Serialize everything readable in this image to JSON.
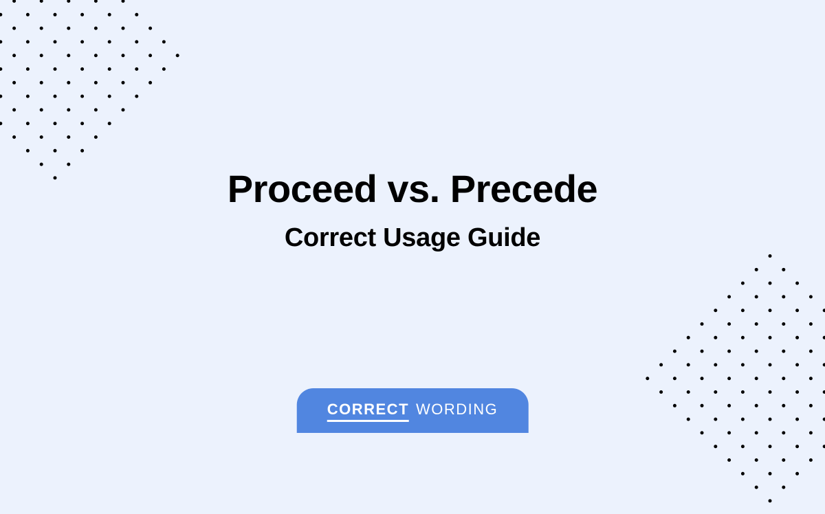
{
  "title": "Proceed vs. Precede",
  "subtitle": "Correct Usage Guide",
  "badge": {
    "left": "CORRECT",
    "right": "WORDING"
  }
}
